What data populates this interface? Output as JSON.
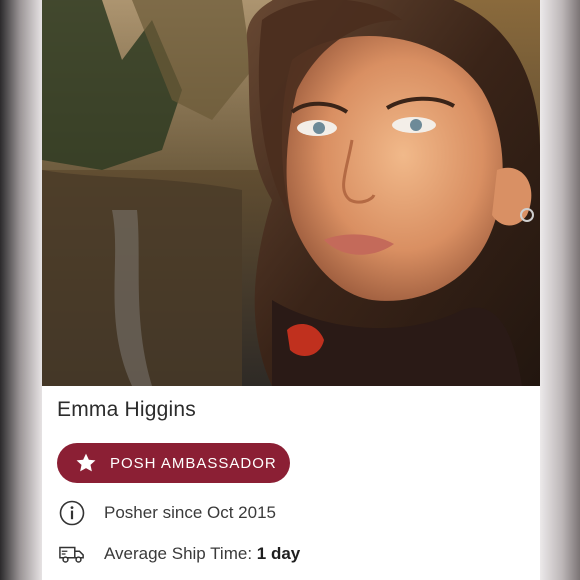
{
  "profile": {
    "name": "Emma Higgins",
    "photo_icon": "profile-photo"
  },
  "badge": {
    "label": "POSH AMBASSADOR",
    "icon": "star-icon",
    "color": "#8b1f34"
  },
  "stats": {
    "posher_since": "Posher since Oct 2015",
    "posher_since_icon": "info-icon",
    "ship_time_label": "Average Ship Time:",
    "ship_time_value": "1 day",
    "ship_time_icon": "delivery-truck-icon"
  }
}
